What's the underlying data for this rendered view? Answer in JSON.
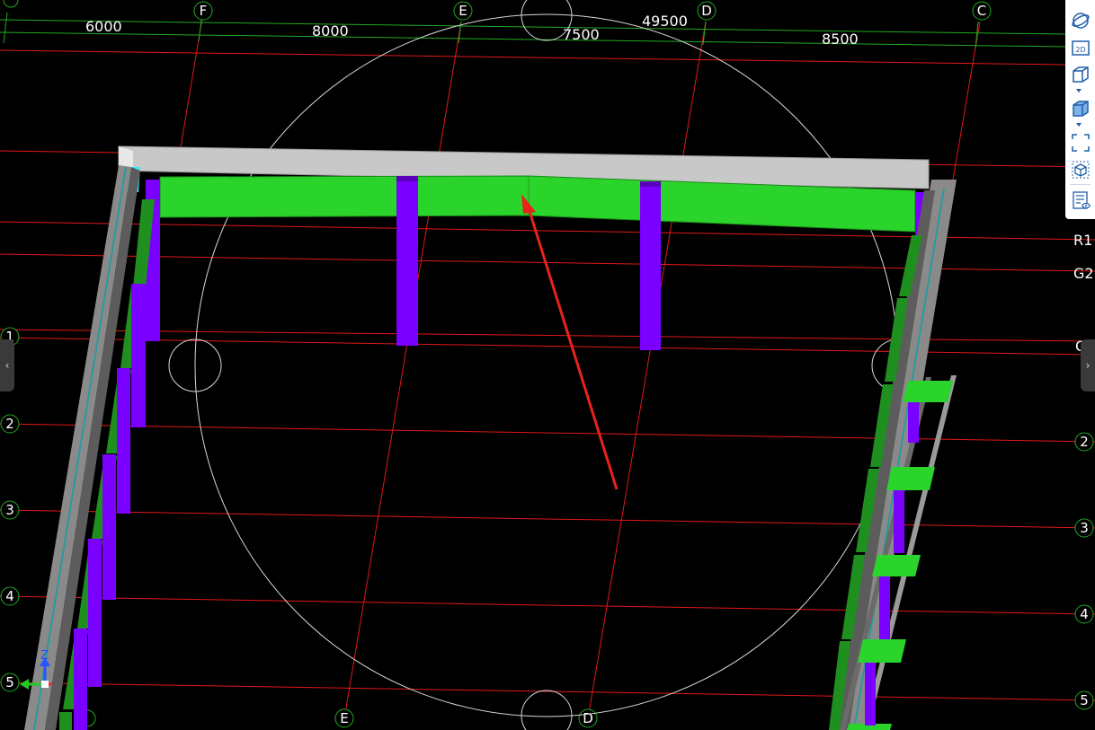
{
  "dimensions": {
    "total": "49500",
    "spans": [
      "6000",
      "8000",
      "7500",
      "8500"
    ]
  },
  "axes": {
    "top_letters": [
      "F",
      "E",
      "D",
      "C"
    ],
    "bottom_letters": [
      "E",
      "D"
    ],
    "left_numbers": [
      "1",
      "2",
      "3",
      "4",
      "5"
    ],
    "right_numbers": [
      "2",
      "3",
      "4",
      "5"
    ],
    "right_floor_labels": [
      "R1",
      "G2"
    ],
    "right_partial_label": "G"
  },
  "toolbar": {
    "buttons": [
      {
        "icon": "orbit-icon"
      },
      {
        "icon": "view-2d-icon",
        "label": "2D"
      },
      {
        "icon": "wireframe-cube-icon"
      },
      {
        "icon": "solid-cube-icon"
      },
      {
        "icon": "fit-view-icon"
      },
      {
        "icon": "section-box-icon"
      },
      {
        "icon": "properties-panel-icon"
      }
    ]
  },
  "gizmo": {
    "axis_z_label": "Z"
  },
  "handles": {
    "left": "‹",
    "right": "›"
  },
  "colors": {
    "grid_red": "#e01818",
    "dim_green": "#22aa22",
    "beam_green": "#2bd42b",
    "column_purple": "#7a00ff",
    "slab_gray": "#c8c8c8",
    "cyan_cap": "#33eeff",
    "arrow_red": "#e8231c",
    "toolbar_blue": "#1f5fa8"
  }
}
